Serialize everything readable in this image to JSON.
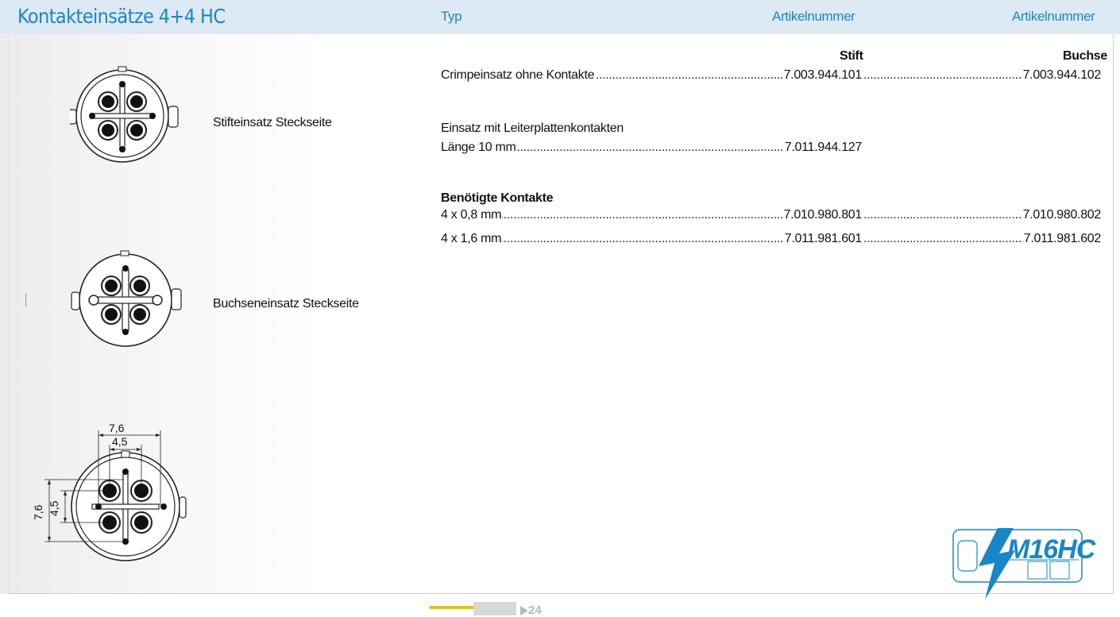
{
  "header": {
    "title": "Kontakteinsätze 4+4 HC",
    "col_typ": "Typ",
    "col_art1": "Artikelnummer",
    "col_art2": "Artikelnummer"
  },
  "images": {
    "pin_insert_label": "Stifteinsatz Steckseite",
    "socket_insert_label": "Buchseneinsatz Steckseite"
  },
  "dimensions": {
    "outer_width": "7,6",
    "inner_width": "4,5",
    "outer_height": "7,6",
    "inner_height": "4,5"
  },
  "table": {
    "stift": "Stift",
    "buchse": "Buchse",
    "crimp": {
      "label": "Crimpeinsatz ohne Kontakte",
      "stift": "7.003.944.101",
      "buchse": "7.003.944.102"
    },
    "pcb_heading": "Einsatz mit Leiterplattenkontakten",
    "pcb": {
      "label": "Länge 10 mm",
      "stift": "7.011.944.127"
    },
    "contacts_heading": "Benötigte Kontakte",
    "contact_08": {
      "label": "4 x 0,8 mm",
      "stift": "7.010.980.801",
      "buchse": "7.010.980.802"
    },
    "contact_16": {
      "label": "4 x 1,6 mm",
      "stift": "7.011.981.601",
      "buchse": "7.011.981.602"
    }
  },
  "logo": {
    "text_m16": "M16",
    "text_hc": "HC"
  },
  "footer": {
    "page_number": "24"
  },
  "colors": {
    "accent": "#1a86c6",
    "header_bg": "#dde9f3",
    "bolt": "#1a86c6"
  }
}
